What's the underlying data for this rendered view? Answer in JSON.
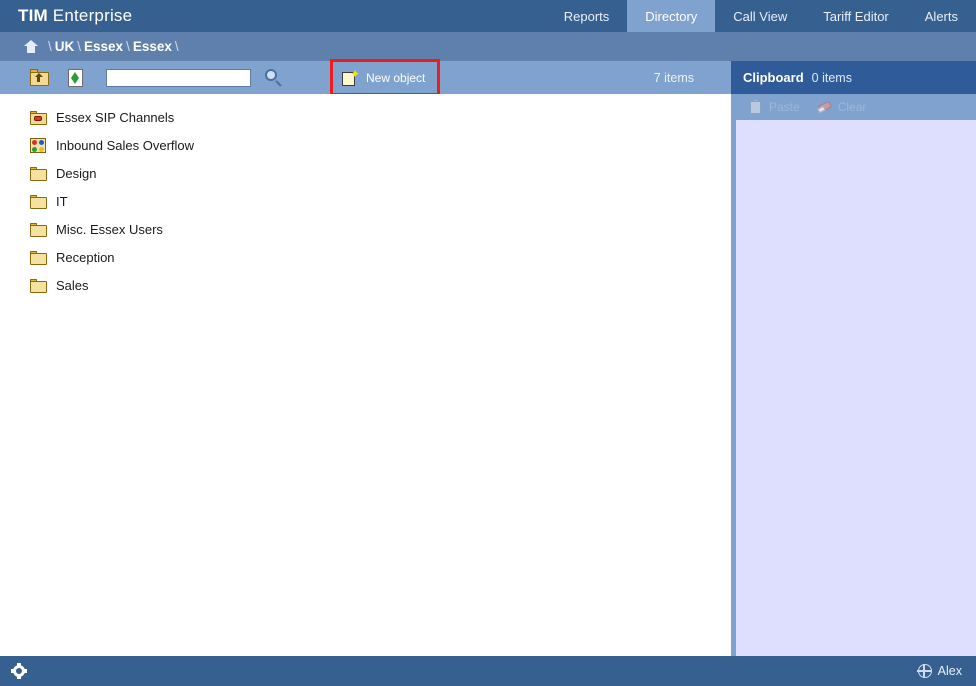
{
  "app": {
    "brand_bold": "TIM",
    "brand_light": " Enterprise"
  },
  "nav": {
    "tabs": [
      {
        "label": "Reports",
        "active": false
      },
      {
        "label": "Directory",
        "active": true
      },
      {
        "label": "Call View",
        "active": false
      },
      {
        "label": "Tariff Editor",
        "active": false
      },
      {
        "label": "Alerts",
        "active": false
      }
    ]
  },
  "breadcrumb": {
    "home_icon": "home-icon",
    "sep": "\\",
    "nodes": [
      "UK",
      "Essex",
      "Essex"
    ]
  },
  "toolbar": {
    "up_icon": "folder-up-icon",
    "refresh_icon": "refresh-icon",
    "search_value": "",
    "search_placeholder": "",
    "search_icon": "magnifier-icon",
    "new_object_icon": "new-page-sparkle-icon",
    "new_object_label": "New object",
    "item_count": "7 items"
  },
  "clipboard": {
    "title": "Clipboard",
    "count": "0 items",
    "paste_icon": "clipboard-icon",
    "paste_label": "Paste",
    "clear_icon": "eraser-icon",
    "clear_label": "Clear"
  },
  "list": {
    "rows": [
      {
        "icon": "folder-red-object-icon",
        "label": "Essex SIP Channels"
      },
      {
        "icon": "multicolor-dots-icon",
        "label": "Inbound Sales Overflow"
      },
      {
        "icon": "folder-icon",
        "label": "Design"
      },
      {
        "icon": "folder-icon",
        "label": "IT"
      },
      {
        "icon": "folder-icon",
        "label": "Misc. Essex Users"
      },
      {
        "icon": "folder-icon",
        "label": "Reception"
      },
      {
        "icon": "folder-icon",
        "label": "Sales"
      }
    ]
  },
  "footer": {
    "settings_icon": "gear-icon",
    "user_icon": "user-globe-icon",
    "user_name": "Alex"
  },
  "colors": {
    "topbar": "#36608f",
    "breadcrumb_bar": "#5f80ad",
    "toolbar": "#7fa2cf",
    "clipboard_header": "#2f5c99",
    "clipboard_body": "#dedeff",
    "highlight": "#ee1c1c",
    "content": "#ffffff"
  }
}
